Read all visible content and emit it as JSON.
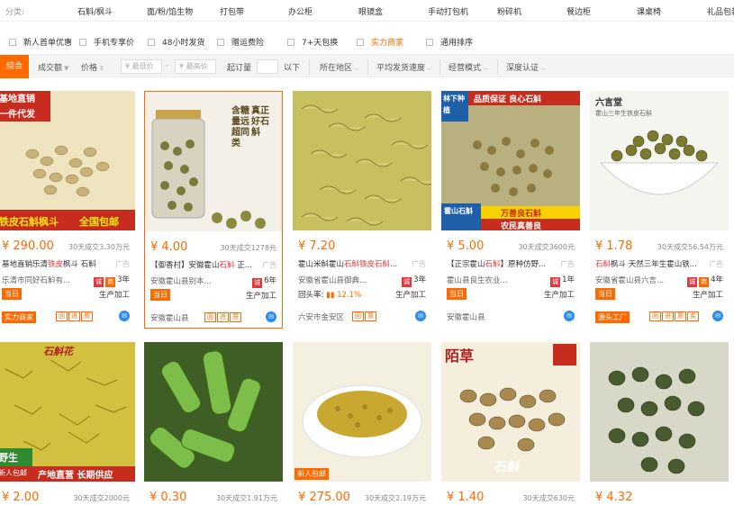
{
  "categories": {
    "label": "分类:",
    "items": [
      "石斛/枫斗",
      "面/粉/馅生物",
      "打包带",
      "办公柜",
      "眼镜盒",
      "手动打包机",
      "粉碎机",
      "餐边柜",
      "课桌椅",
      "礼品包装"
    ]
  },
  "options": [
    {
      "label": "新人首单优惠",
      "orange": false
    },
    {
      "label": "手机专享价",
      "orange": false
    },
    {
      "label": "48小时发货",
      "orange": false
    },
    {
      "label": "赠运费险",
      "orange": false
    },
    {
      "label": "7+天包换",
      "orange": false
    },
    {
      "label": "实力商家",
      "orange": true
    },
    {
      "label": "通用排序",
      "orange": false
    }
  ],
  "sort": {
    "active": "综合",
    "sales": "成交额",
    "price": "价格",
    "min_placeholder": "¥ 最低价",
    "max_placeholder": "¥ 最高价",
    "moq": "起订量",
    "below": "以下",
    "region": "所在地区",
    "ship": "平均发货速度",
    "mode": "经营模式",
    "cert": "深度认证"
  },
  "products": [
    {
      "price": "¥ 290.00",
      "deal": "30天成交3.30万元",
      "title_pre": "基地直销乐清",
      "title_hl": "铁皮",
      "title_post": "枫斗 石斛",
      "shop": "乐清市同好石斛有...",
      "years": "3年",
      "same_day": "当日",
      "prod": "生产加工",
      "loc": "",
      "tag": "实力商家",
      "mini": [
        "回",
        "进",
        "质"
      ],
      "img_text": [
        "基地直销",
        "一件代发",
        "铁皮石斛枫斗",
        "全国包邮"
      ],
      "hue": "#efe4c0"
    },
    {
      "price": "¥ 4.00",
      "deal": "30天成交1278元",
      "title_pre": "【御香村】安徽霍山",
      "title_hl": "石斛",
      "title_post": " 正...",
      "shop": "安徽霍山县别本...",
      "years": "6年",
      "same_day": "当日",
      "prod": "生产加工",
      "loc": "安徽霍山县",
      "tag": "",
      "mini": [
        "回",
        "进",
        "质"
      ],
      "img_text": [
        "真正好石斛",
        "含糖量远超同类"
      ],
      "hue": "#f4f0e8"
    },
    {
      "price": "¥ 7.20",
      "deal": "",
      "title_pre": "霍山米斛霍山",
      "title_hl": "石斛铁皮石斛",
      "title_post": "...",
      "shop": "安徽省霍山县御典...",
      "years": "3年",
      "same_day": "",
      "prod": "生产加工",
      "loc": "六安市金安区",
      "tag": "",
      "mini": [
        "回",
        "质"
      ],
      "trade": "回头率:",
      "pct": "12.1%",
      "img_text": [],
      "hue": "#c8c060"
    },
    {
      "price": "¥ 5.00",
      "deal": "30天成交3600元",
      "title_pre": "【正宗霍山",
      "title_hl": "石斛",
      "title_post": "】原种仿野...",
      "shop": "霍山县良生农业...",
      "years": "1年",
      "same_day": "当日",
      "prod": "生产加工",
      "loc": "安徽霍山县",
      "tag": "",
      "mini": [],
      "img_text": [
        "林下种植",
        "品质保证 良心石斛",
        "霍山石斛",
        "万善良石斛",
        "农民真善良"
      ],
      "hue": "#b9b080"
    },
    {
      "price": "¥ 1.78",
      "deal": "30天成交56.54万元",
      "title_pre": "",
      "title_hl": "石斛",
      "title_post": "枫斗 天然三年生霍山铁...",
      "shop": "安徽省霍山县六言...",
      "years": "4年",
      "same_day": "当日",
      "prod": "生产加工",
      "loc": "",
      "tag": "源头工厂",
      "mini": [
        "回",
        "进",
        "质",
        "实"
      ],
      "img_text": [
        "六言堂",
        "霍山三年生铁皮石斛"
      ],
      "hue": "#f5f5f0"
    },
    {
      "price": "¥ 2.00",
      "deal": "30天成交2000元",
      "img_text": [
        "石斛花",
        "野生",
        "新人包邮",
        "产地直营 长期供应"
      ],
      "hue": "#d4c040"
    },
    {
      "price": "¥ 0.30",
      "deal": "30天成交1.91万元",
      "img_text": [],
      "hue": "#6a9a40"
    },
    {
      "price": "¥ 275.00",
      "deal": "30天成交2.19万元",
      "img_text": [
        "新人包邮"
      ],
      "hue": "#f4f0e0"
    },
    {
      "price": "¥ 1.40",
      "deal": "30天成交630元",
      "img_text": [
        "陌草",
        "石斛"
      ],
      "hue": "#f5eedd"
    },
    {
      "price": "¥ 4.32",
      "deal": "",
      "img_text": [],
      "hue": "#d8d8c8"
    }
  ],
  "common": {
    "ad": "广告"
  }
}
